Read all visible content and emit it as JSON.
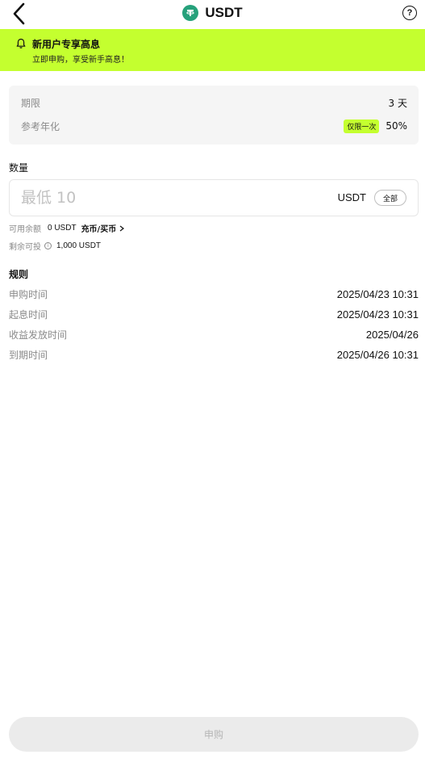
{
  "header": {
    "title": "USDT",
    "help_glyph": "?"
  },
  "banner": {
    "title": "新用户专享高息",
    "subtitle": "立即申购，享受新手高息！"
  },
  "info": {
    "term_label": "期限",
    "term_value": "3 天",
    "apr_label": "参考年化",
    "apr_badge": "仅限一次",
    "apr_value": "50%"
  },
  "amount": {
    "label": "数量",
    "placeholder": "最低 10",
    "unit": "USDT",
    "all_button": "全部"
  },
  "balance": {
    "available_label": "可用余额",
    "available_value": "0 USDT",
    "deposit_link": "充币/买币",
    "remaining_label": "剩余可投",
    "remaining_value": "1,000 USDT"
  },
  "rules": {
    "title": "规则",
    "items": [
      {
        "label": "申购时间",
        "value": "2025/04/23 10:31"
      },
      {
        "label": "起息时间",
        "value": "2025/04/23 10:31"
      },
      {
        "label": "收益发放时间",
        "value": "2025/04/26"
      },
      {
        "label": "到期时间",
        "value": "2025/04/26 10:31"
      }
    ]
  },
  "submit": {
    "label": "申购"
  },
  "colors": {
    "accent": "#c4ff2f",
    "usdt": "#26a17b",
    "muted": "#8a8a8a"
  },
  "icons": [
    "back-arrow-icon",
    "usdt-coin-icon",
    "help-icon",
    "bell-icon",
    "chevron-right-icon",
    "info-icon"
  ]
}
